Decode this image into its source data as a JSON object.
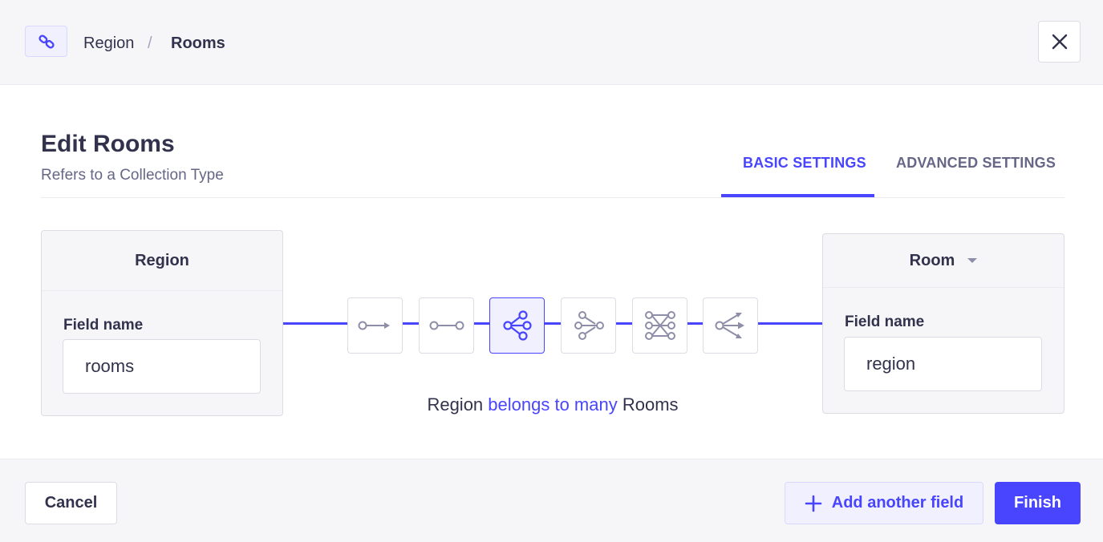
{
  "header": {
    "icon": "link-icon",
    "breadcrumb": [
      "Region",
      "Rooms"
    ],
    "separator": "/",
    "close_icon": "close-icon"
  },
  "main": {
    "title": "Edit Rooms",
    "subtitle": "Refers to a Collection Type",
    "tabs": [
      {
        "label": "BASIC SETTINGS",
        "active": true
      },
      {
        "label": "ADVANCED SETTINGS",
        "active": false
      }
    ]
  },
  "left_card": {
    "title": "Region",
    "field_label": "Field name",
    "field_value": "rooms"
  },
  "right_card": {
    "title": "Room",
    "field_label": "Field name",
    "field_value": "region"
  },
  "relations": [
    {
      "icon": "one-way-relation-icon",
      "active": false
    },
    {
      "icon": "one-to-one-relation-icon",
      "active": false
    },
    {
      "icon": "one-to-many-relation-icon",
      "active": true
    },
    {
      "icon": "many-to-one-relation-icon",
      "active": false
    },
    {
      "icon": "many-to-many-relation-icon",
      "active": false
    },
    {
      "icon": "many-way-relation-icon",
      "active": false
    }
  ],
  "relation_text": {
    "from": "Region",
    "verb": "belongs to many",
    "to": "Rooms"
  },
  "footer": {
    "cancel_label": "Cancel",
    "add_label": "Add another field",
    "finish_label": "Finish"
  },
  "colors": {
    "accent": "#4945ff",
    "accent_light": "#f0f0ff",
    "icon_gray": "#8e8ea9"
  }
}
